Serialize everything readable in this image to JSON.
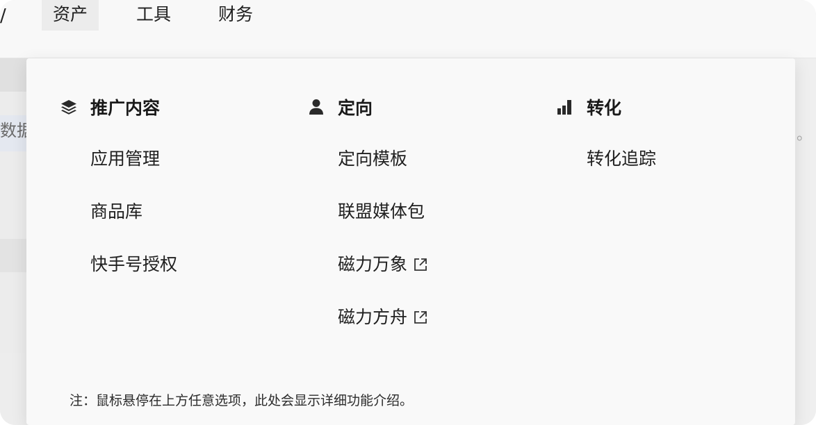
{
  "topnav": {
    "stub": "/",
    "items": [
      {
        "label": "资产",
        "active": true
      },
      {
        "label": "工具",
        "active": false
      },
      {
        "label": "财务",
        "active": false
      }
    ]
  },
  "background": {
    "left_text": "数据",
    "right_text": "。"
  },
  "menu": {
    "columns": [
      {
        "title": "推广内容",
        "icon": "layers-icon",
        "items": [
          {
            "label": "应用管理",
            "external": false
          },
          {
            "label": "商品库",
            "external": false
          },
          {
            "label": "快手号授权",
            "external": false
          }
        ]
      },
      {
        "title": "定向",
        "icon": "user-icon",
        "items": [
          {
            "label": "定向模板",
            "external": false
          },
          {
            "label": "联盟媒体包",
            "external": false
          },
          {
            "label": "磁力万象",
            "external": true
          },
          {
            "label": "磁力方舟",
            "external": true
          }
        ]
      },
      {
        "title": "转化",
        "icon": "bar-chart-icon",
        "items": [
          {
            "label": "转化追踪",
            "external": false
          }
        ]
      }
    ],
    "note": "注：鼠标悬停在上方任意选项，此处会显示详细功能介绍。"
  },
  "colors": {
    "panel_bg": "#f9f9f9",
    "active_nav_bg": "#ececec",
    "text": "#1f1f1f"
  }
}
